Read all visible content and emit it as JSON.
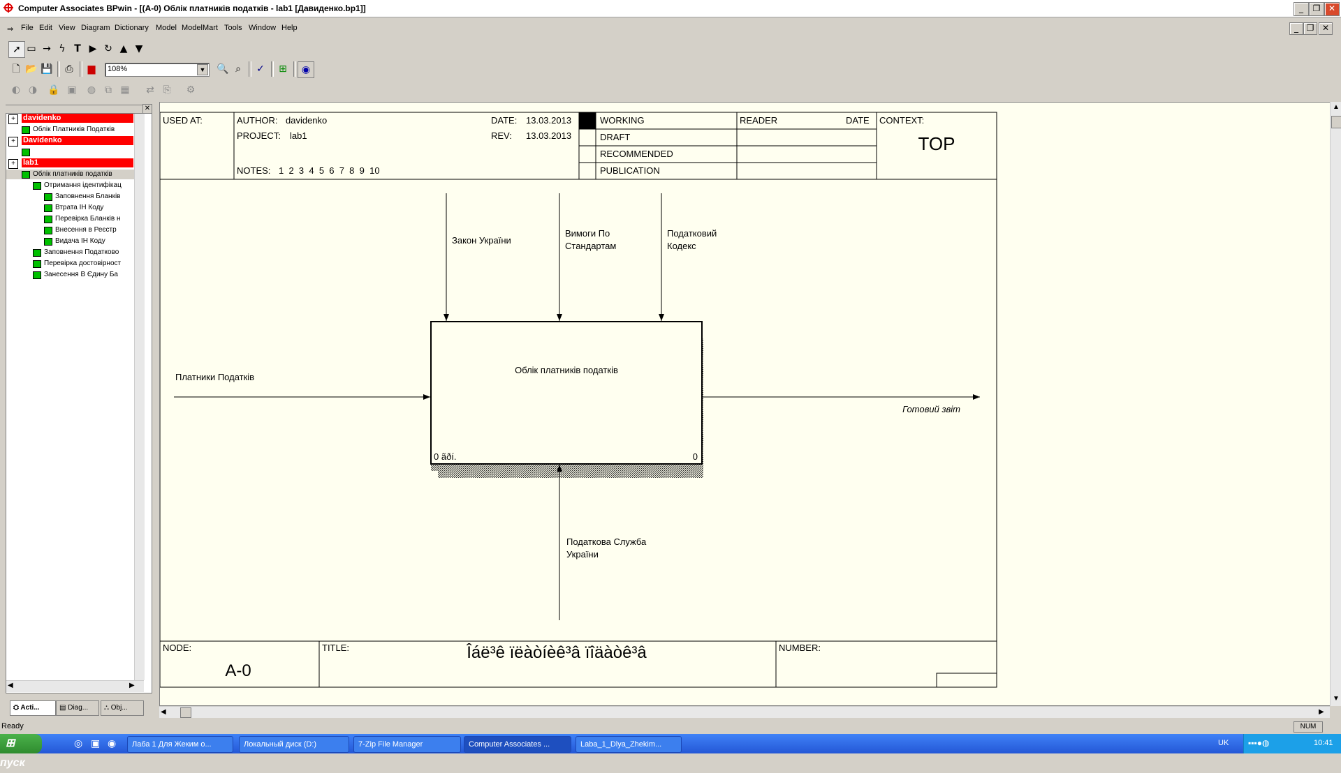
{
  "window": {
    "title": "Computer Associates BPwin - [(A-0) Облік платників податків     - lab1  [Давиденко.bp1]]",
    "min": "_",
    "restore": "❐",
    "close": "✕"
  },
  "menu": [
    "File",
    "Edit",
    "View",
    "Diagram",
    "Dictionary",
    "Model",
    "ModelMart",
    "Tools",
    "Window",
    "Help"
  ],
  "toolbar": {
    "zoom_value": "108%"
  },
  "tree": {
    "models": [
      {
        "name": "davidenko",
        "children": [
          {
            "label": "Облік Платників Податків",
            "level": 1
          }
        ]
      },
      {
        "name": "Davidenko",
        "children": [
          {
            "label": "",
            "level": 1
          }
        ]
      },
      {
        "name": "lab1",
        "children": [
          {
            "label": "Облік платників податків",
            "level": 1
          },
          {
            "label": "Отримання ідентифікац",
            "level": 2
          },
          {
            "label": "Заповнення Бланків",
            "level": 3
          },
          {
            "label": "Втрата ІН Коду",
            "level": 3
          },
          {
            "label": "Перевірка Бланків н",
            "level": 3
          },
          {
            "label": "Внесення в Реєстр",
            "level": 3
          },
          {
            "label": "Видача ІН Коду",
            "level": 3
          },
          {
            "label": "Заповнення Податково",
            "level": 2
          },
          {
            "label": "Перевірка достовірност",
            "level": 2
          },
          {
            "label": "Занесення В Єдину  Ба",
            "level": 2
          }
        ]
      }
    ],
    "tabs": [
      "Acti...",
      "Diag...",
      "Obj..."
    ]
  },
  "frame": {
    "used_at": "USED AT:",
    "author_label": "AUTHOR:",
    "author": "davidenko",
    "project_label": "PROJECT:",
    "project": "lab1",
    "date_label": "DATE:",
    "date": "13.03.2013",
    "rev_label": "REV:",
    "rev": "13.03.2013",
    "notes_label": "NOTES:",
    "notes": "1  2  3  4  5  6  7  8  9  10",
    "status": [
      "WORKING",
      "DRAFT",
      "RECOMMENDED",
      "PUBLICATION"
    ],
    "reader": "READER",
    "reader_date": "DATE",
    "context_label": "CONTEXT:",
    "context": "TOP",
    "node_label": "NODE:",
    "node": "A-0",
    "title_label": "TITLE:",
    "title": "Îáë³ê ïëàòíèê³â ïîäàòê³â",
    "number_label": "NUMBER:"
  },
  "diagram": {
    "activity": "Облік платників податків",
    "cost": "0 ãðí.",
    "box_number": "0",
    "controls": [
      "Закон України",
      "Вимоги По\nСтандартам",
      "Податковий\nКодекс"
    ],
    "input": "Платники Податків",
    "output": "Готовий звіт",
    "mechanism": "Податкова Служба\nУкраїни"
  },
  "status": {
    "text": "Ready",
    "num": "NUM"
  },
  "taskbar": {
    "start": "пуск",
    "tasks": [
      "Лаба 1 Для Жеким о...",
      "Локальный диск (D:)",
      "7-Zip File Manager",
      "Computer Associates ...",
      "Laba_1_Dlya_Zhekim..."
    ],
    "lang": "UK",
    "clock": "10:41"
  }
}
